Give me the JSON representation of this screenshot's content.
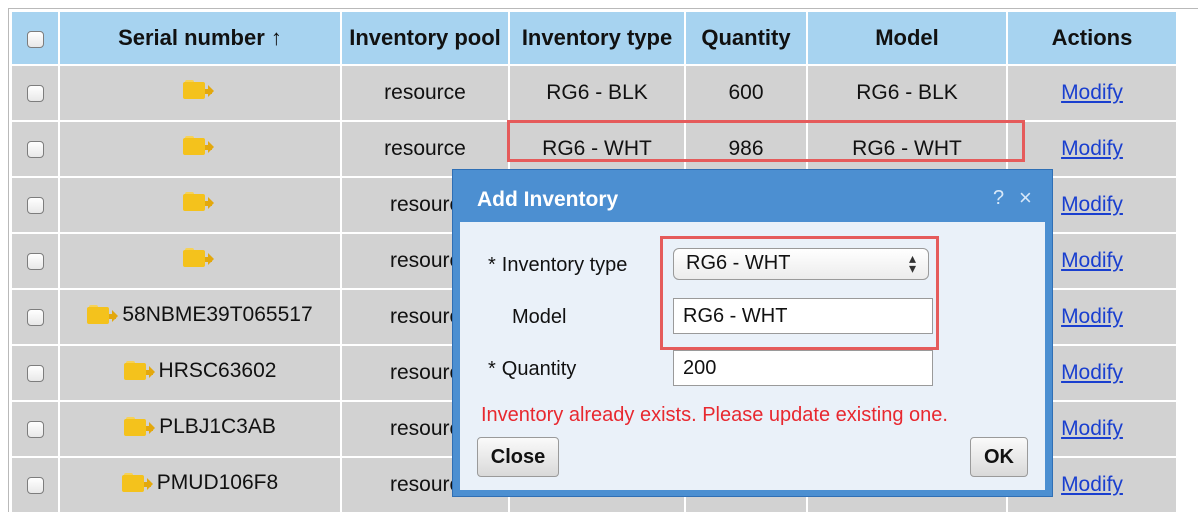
{
  "table": {
    "headers": {
      "serial_number": "Serial number ↑",
      "inventory_pool": "Inventory pool",
      "inventory_type": "Inventory type",
      "quantity": "Quantity",
      "model": "Model",
      "actions": "Actions"
    },
    "rows": [
      {
        "serial": "",
        "pool": "resource",
        "type": "RG6 - BLK",
        "quantity": "600",
        "model": "RG6 - BLK",
        "action": "Modify"
      },
      {
        "serial": "",
        "pool": "resource",
        "type": "RG6 - WHT",
        "quantity": "986",
        "model": "RG6 - WHT",
        "action": "Modify"
      },
      {
        "serial": "",
        "pool": "resourc",
        "type": "",
        "quantity": "",
        "model": "",
        "action": "Modify"
      },
      {
        "serial": "",
        "pool": "resourc",
        "type": "",
        "quantity": "",
        "model": "",
        "action": "Modify"
      },
      {
        "serial": "58NBME39T065517",
        "pool": "resourc",
        "type": "",
        "quantity": "",
        "model": "",
        "action": "Modify"
      },
      {
        "serial": "HRSC63602",
        "pool": "resourc",
        "type": "",
        "quantity": "",
        "model": "",
        "action": "Modify"
      },
      {
        "serial": "PLBJ1C3AB",
        "pool": "resourc",
        "type": "",
        "quantity": "",
        "model": "",
        "action": "Modify"
      },
      {
        "serial": "PMUD106F8",
        "pool": "resourc",
        "type": "",
        "quantity": "",
        "model": "",
        "action": "Modify"
      }
    ]
  },
  "dialog": {
    "title": "Add Inventory",
    "help": "?",
    "close": "×",
    "required_mark": "*",
    "inventory_type_label": "Inventory type",
    "inventory_type_value": "RG6 - WHT",
    "model_label": "Model",
    "model_value": "RG6 - WHT",
    "quantity_label": "Quantity",
    "quantity_value": "200",
    "error": "Inventory already exists. Please update existing one.",
    "close_button": "Close",
    "ok_button": "OK"
  },
  "colors": {
    "header_bg": "#a7d3f0",
    "row_bg": "#d2d2d2",
    "dialog_frame": "#4c8fd1",
    "highlight": "#e55b5b",
    "error_text": "#e8282f",
    "link": "#1a3fcf"
  },
  "icons": {
    "row_icon": "folder-icon",
    "select_icon": "chevron-updown-icon"
  }
}
